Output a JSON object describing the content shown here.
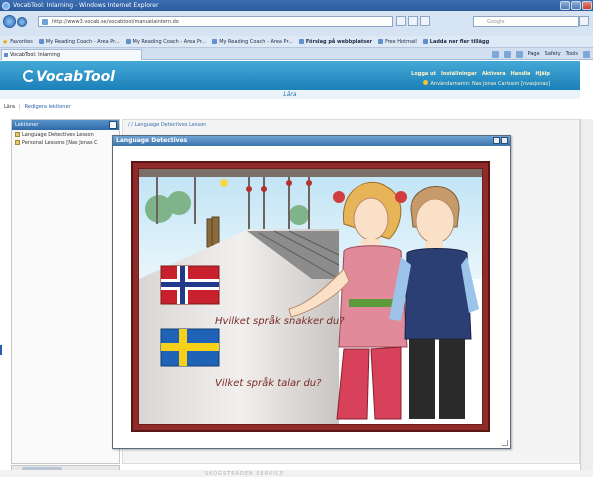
{
  "browser": {
    "title": "VocabTool: Inlarning - Windows Internet Explorer",
    "url": "http://www3.vocab.se/vocabtool/manuelaintern.do",
    "search_placeholder": "Google",
    "tab_label": "VocabTool: Inlarning",
    "favorites": [
      {
        "label": "Favorites",
        "bold": false
      },
      {
        "label": "My Reading Coach - Area Pr...",
        "bold": false
      },
      {
        "label": "My Reading Coach - Area Pr...",
        "bold": false
      },
      {
        "label": "My Reading Coach - Area Pr...",
        "bold": false
      },
      {
        "label": "Förslag på webbplatser",
        "bold": true
      },
      {
        "label": "Free Hotmail",
        "bold": false
      },
      {
        "label": "Ladda ner fler tillägg",
        "bold": true
      }
    ],
    "commands": [
      "Page",
      "Safety",
      "Tools"
    ]
  },
  "app": {
    "logo": "VocabTool",
    "menu": [
      "Logga ut",
      "Inställningar",
      "Aktivera",
      "Handla",
      "Hjälp"
    ],
    "user_line": "Användarnamn: Nas Jonas Carlsson [nvasjonas]",
    "section_title": "Lära",
    "subnav": {
      "current": "Lära",
      "link": "Redigera lektioner"
    }
  },
  "left_panel": {
    "title": "Lektioner",
    "items": [
      "Language Detectives Lesson",
      "Personal Lessons [Nas Jonas C"
    ]
  },
  "breadcrumb": "/ / Language Detectives Lesson",
  "popup": {
    "title": "Language Detectives",
    "question_1": "Hvilket språk snakker du?",
    "question_2": "Vilket språk talar du?"
  },
  "footer_text": "SKOGSTRÄDEN SERVICE",
  "colors": {
    "header_blue": "#1c80ba",
    "frame_red": "#8f2c2a",
    "text_red": "#7a2b27"
  }
}
